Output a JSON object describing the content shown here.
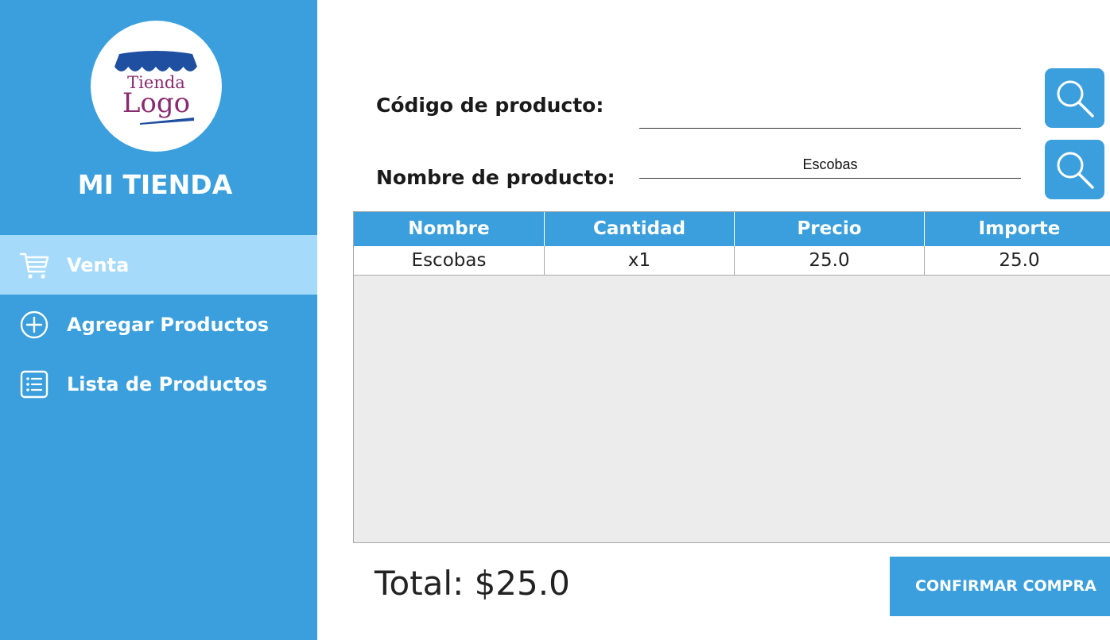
{
  "sidebar": {
    "logo_line1": "Tienda",
    "logo_line2": "Logo",
    "store_name": "MI TIENDA",
    "items": [
      {
        "label": "Venta",
        "icon": "cart-icon",
        "active": true
      },
      {
        "label": "Agregar Productos",
        "icon": "plus-circle-icon",
        "active": false
      },
      {
        "label": "Lista de Productos",
        "icon": "list-icon",
        "active": false
      }
    ]
  },
  "form": {
    "code_label": "Código de producto:",
    "code_value": "",
    "name_label": "Nombre de producto:",
    "name_value": "Escobas"
  },
  "table": {
    "columns": [
      "Nombre",
      "Cantidad",
      "Precio",
      "Importe"
    ],
    "rows": [
      [
        "Escobas",
        "x1",
        "25.0",
        "25.0"
      ]
    ]
  },
  "footer": {
    "total": "Total: $25.0",
    "confirm_label": "CONFIRMAR COMPRA"
  },
  "colors": {
    "primary": "#3a9fdc",
    "active_nav": "#a6dafa",
    "logo_text": "#8a2a6f",
    "awning": "#1f4fa0"
  }
}
